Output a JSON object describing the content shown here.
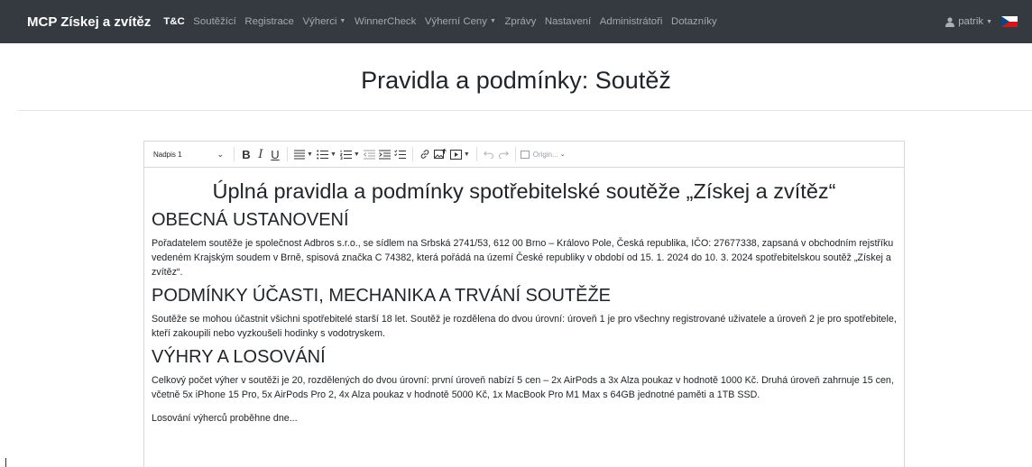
{
  "navbar": {
    "brand": "MCP Získej a zvítěz",
    "items": [
      {
        "label": "T&C",
        "active": true,
        "dropdown": false
      },
      {
        "label": "Soutěžící",
        "active": false,
        "dropdown": false
      },
      {
        "label": "Registrace",
        "active": false,
        "dropdown": false
      },
      {
        "label": "Výherci",
        "active": false,
        "dropdown": true
      },
      {
        "label": "WinnerCheck",
        "active": false,
        "dropdown": false
      },
      {
        "label": "Výherní Ceny",
        "active": false,
        "dropdown": true
      },
      {
        "label": "Zprávy",
        "active": false,
        "dropdown": false
      },
      {
        "label": "Nastavení",
        "active": false,
        "dropdown": false
      },
      {
        "label": "Administrátoři",
        "active": false,
        "dropdown": false
      },
      {
        "label": "Dotazníky",
        "active": false,
        "dropdown": false
      }
    ],
    "user": "patrik",
    "language_flag": "cz-flag-icon"
  },
  "page": {
    "title": "Pravidla a podmínky: Soutěž"
  },
  "editor": {
    "toolbar": {
      "heading_select": "Nadpis 1",
      "source_label": "Origin..."
    },
    "content": {
      "h1": "Úplná pravidla a podmínky spotřebitelské soutěže „Získej a zvítěz“",
      "sections": [
        {
          "heading": "OBECNÁ USTANOVENÍ",
          "text": "Pořadatelem soutěže je společnost Adbros s.r.o., se sídlem na Srbská 2741/53, 612 00 Brno – Královo Pole, Česká republika, IČO: 27677338, zapsaná v obchodním rejstříku vedeném Krajským soudem v Brně, spisová značka C 74382, která pořádá na území České republiky v období od 15. 1. 2024 do 10. 3. 2024 spotřebitelskou soutěž „Získej a zvítěz“."
        },
        {
          "heading": "PODMÍNKY ÚČASTI, MECHANIKA A TRVÁNÍ SOUTĚŽE",
          "text": "Soutěže se mohou účastnit všichni spotřebitelé starší 18 let. Soutěž je rozdělena do dvou úrovní: úroveň 1 je pro všechny registrované uživatele a úroveň 2 je pro spotřebitele, kteří zakoupili nebo vyzkoušeli hodinky s vodotryskem."
        },
        {
          "heading": "VÝHRY A LOSOVÁNÍ",
          "text": "Celkový počet výher v soutěži je 20, rozdělených do dvou úrovní: první úroveň nabízí 5 cen – 2x AirPods a 3x Alza poukaz v hodnotě 1000 Kč. Druhá úroveň zahrnuje 15 cen, včetně 5x iPhone 15 Pro, 5x AirPods Pro 2, 4x Alza poukaz v hodnotě 5000 Kč, 1x MacBook Pro M1 Max s 64GB jednotné paměti a 1TB SSD."
        }
      ],
      "trailing_text": "Losování výherců proběhne dne..."
    }
  },
  "colors": {
    "navbar_bg": "#343a40",
    "text": "#212529",
    "border": "#d6d9dc"
  }
}
